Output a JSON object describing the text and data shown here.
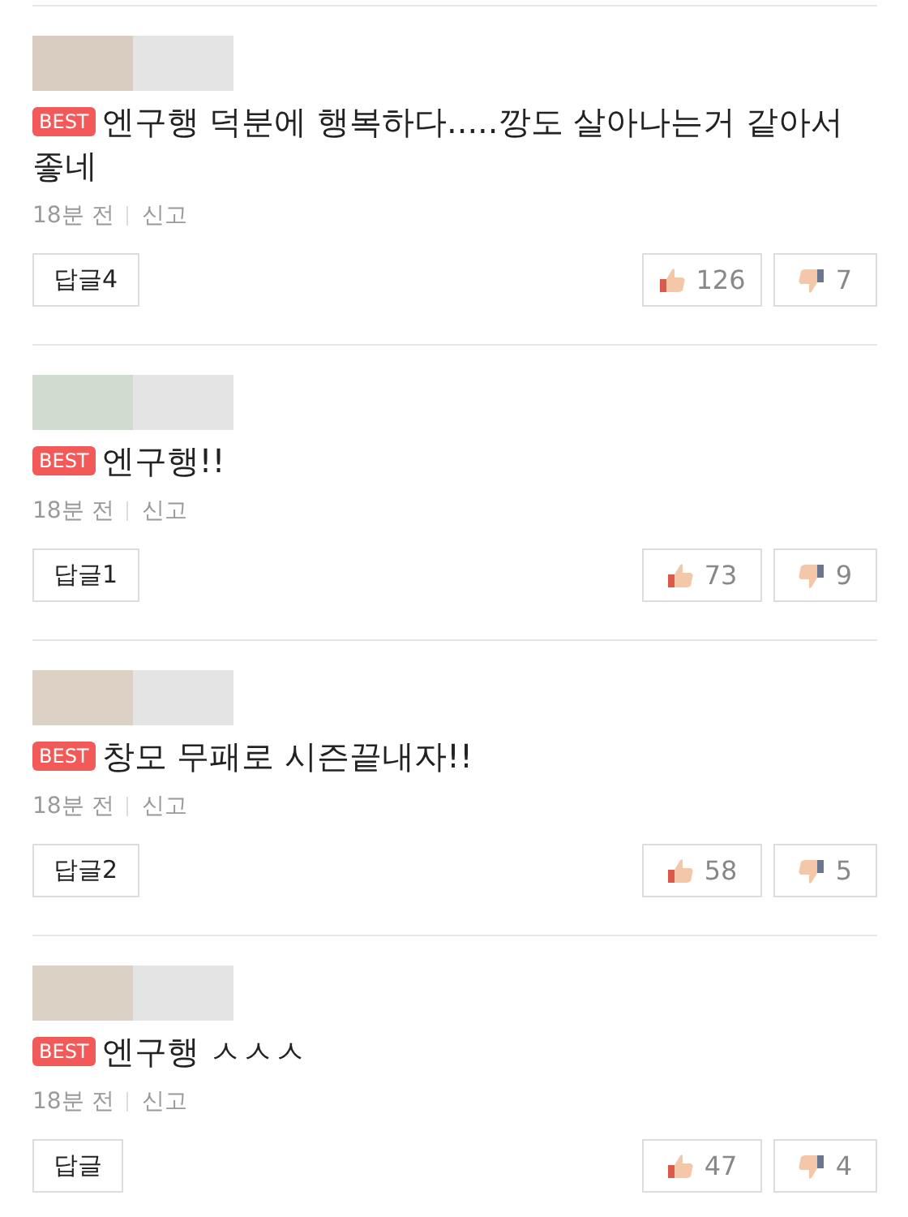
{
  "comments": [
    {
      "color": "#d8cdc0",
      "badge": "BEST",
      "text": "엔구행 덕분에 행복하다.....깡도 살아나는거 같아서 좋네",
      "time": "18분 전",
      "report": "신고",
      "reply": "답글4",
      "likes": "126",
      "dislikes": "7"
    },
    {
      "color": "#cfdccf",
      "badge": "BEST",
      "text": "엔구행!!",
      "time": "18분 전",
      "report": "신고",
      "reply": "답글1",
      "likes": "73",
      "dislikes": "9"
    },
    {
      "color": "#ddd0c4",
      "badge": "BEST",
      "text": "창모 무패로 시즌끝내자!!",
      "time": "18분 전",
      "report": "신고",
      "reply": "답글2",
      "likes": "58",
      "dislikes": "5"
    },
    {
      "color": "#dcd1c5",
      "badge": "BEST",
      "text": "엔구행 ㅅㅅㅅ",
      "time": "18분 전",
      "report": "신고",
      "reply": "답글",
      "likes": "47",
      "dislikes": "4"
    }
  ]
}
